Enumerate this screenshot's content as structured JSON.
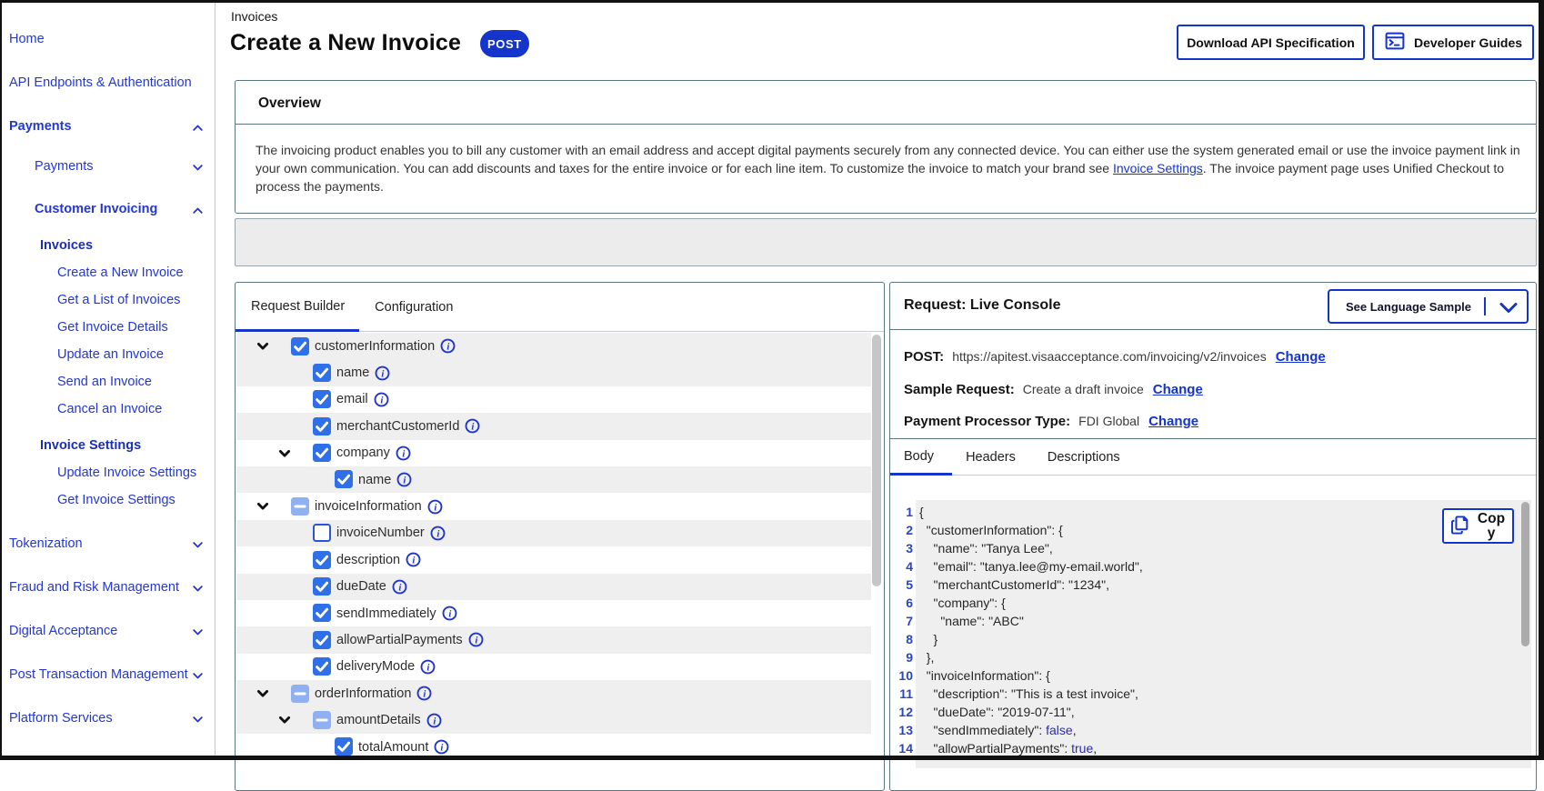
{
  "colors": {
    "accent": "#1434cb",
    "checkbox": "#2f6fe8",
    "checkbox_partial": "#8fb1f2",
    "panel_border": "#5a7584",
    "row_stripe": "#efefef"
  },
  "sidebar": {
    "items": [
      {
        "label": "Home",
        "style": "link",
        "indent": 0
      },
      {
        "label": "API Endpoints & Authentication",
        "style": "top-link",
        "indent": 0
      },
      {
        "label": "Payments",
        "style": "section",
        "indent": 0,
        "chevron": "up"
      },
      {
        "label": "Payments",
        "style": "sub-section",
        "indent": 1,
        "chevron": "down"
      },
      {
        "label": "Customer Invoicing",
        "style": "sub-section-bold",
        "indent": 1,
        "chevron": "up"
      },
      {
        "label": "Invoices",
        "style": "heading",
        "indent": 2
      },
      {
        "label": "Create a New Invoice",
        "style": "link",
        "indent": 3
      },
      {
        "label": "Get a List of Invoices",
        "style": "link",
        "indent": 3
      },
      {
        "label": "Get Invoice Details",
        "style": "link",
        "indent": 3
      },
      {
        "label": "Update an Invoice",
        "style": "link",
        "indent": 3
      },
      {
        "label": "Send an Invoice",
        "style": "link",
        "indent": 3
      },
      {
        "label": "Cancel an Invoice",
        "style": "link",
        "indent": 3
      },
      {
        "label": "Invoice Settings",
        "style": "heading",
        "indent": 2
      },
      {
        "label": "Update Invoice Settings",
        "style": "link",
        "indent": 3
      },
      {
        "label": "Get Invoice Settings",
        "style": "link",
        "indent": 3
      },
      {
        "label": "Tokenization",
        "style": "top-link",
        "indent": 0,
        "chevron": "down"
      },
      {
        "label": "Fraud and Risk Management",
        "style": "top-link",
        "indent": 0,
        "chevron": "down"
      },
      {
        "label": "Digital Acceptance",
        "style": "top-link",
        "indent": 0,
        "chevron": "down"
      },
      {
        "label": "Post Transaction Management",
        "style": "top-link",
        "indent": 0,
        "chevron": "down"
      },
      {
        "label": "Platform Services",
        "style": "top-link",
        "indent": 0,
        "chevron": "down"
      }
    ]
  },
  "header": {
    "breadcrumb": "Invoices",
    "title": "Create a New Invoice",
    "method_badge": "POST",
    "download_button": "Download API Specification",
    "guides_button": "Developer Guides"
  },
  "overview": {
    "title": "Overview",
    "paragraph_before": "The invoicing product enables you to bill any customer with an email address and accept digital payments securely from any connected device. You can either use the system generated email or use the invoice payment link in\nyour own communication. You can add discounts and taxes for the entire invoice or for each line item. To customize the invoice to match your brand see ",
    "paragraph_link": "Invoice Settings",
    "paragraph_after": ". The invoice payment page uses Unified Checkout to\nprocess the payments."
  },
  "request_builder": {
    "tabs": [
      {
        "label": "Request Builder",
        "active": true
      },
      {
        "label": "Configuration",
        "active": false
      }
    ],
    "rows": [
      {
        "label": "customerInformation",
        "depth": 0,
        "state": "checked",
        "chevron": true,
        "shade": "gray"
      },
      {
        "label": "name",
        "depth": 1,
        "state": "checked",
        "chevron": false,
        "shade": "gray"
      },
      {
        "label": "email",
        "depth": 1,
        "state": "checked",
        "chevron": false,
        "shade": "white"
      },
      {
        "label": "merchantCustomerId",
        "depth": 1,
        "state": "checked",
        "chevron": false,
        "shade": "gray"
      },
      {
        "label": "company",
        "depth": 1,
        "state": "checked",
        "chevron": true,
        "shade": "white"
      },
      {
        "label": "name",
        "depth": 2,
        "state": "checked",
        "chevron": false,
        "shade": "gray"
      },
      {
        "label": "invoiceInformation",
        "depth": 0,
        "state": "partial",
        "chevron": true,
        "shade": "white"
      },
      {
        "label": "invoiceNumber",
        "depth": 1,
        "state": "unchecked",
        "chevron": false,
        "shade": "gray"
      },
      {
        "label": "description",
        "depth": 1,
        "state": "checked",
        "chevron": false,
        "shade": "white"
      },
      {
        "label": "dueDate",
        "depth": 1,
        "state": "checked",
        "chevron": false,
        "shade": "gray"
      },
      {
        "label": "sendImmediately",
        "depth": 1,
        "state": "checked",
        "chevron": false,
        "shade": "white"
      },
      {
        "label": "allowPartialPayments",
        "depth": 1,
        "state": "checked",
        "chevron": false,
        "shade": "gray"
      },
      {
        "label": "deliveryMode",
        "depth": 1,
        "state": "checked",
        "chevron": false,
        "shade": "white"
      },
      {
        "label": "orderInformation",
        "depth": 0,
        "state": "partial",
        "chevron": true,
        "shade": "gray"
      },
      {
        "label": "amountDetails",
        "depth": 1,
        "state": "partial",
        "chevron": true,
        "shade": "gray"
      },
      {
        "label": "totalAmount",
        "depth": 2,
        "state": "checked",
        "chevron": false,
        "shade": "white"
      }
    ]
  },
  "console": {
    "title": "Request: Live Console",
    "language_button": "See Language Sample",
    "fields": [
      {
        "label": "POST:",
        "value": "https://apitest.visaacceptance.com/invoicing/v2/invoices",
        "action": "Change"
      },
      {
        "label": "Sample Request:",
        "value": "Create a draft invoice",
        "action": "Change"
      },
      {
        "label": "Payment Processor Type:",
        "value": "FDI Global",
        "action": "Change"
      }
    ],
    "tabs": [
      {
        "label": "Body",
        "active": true
      },
      {
        "label": "Headers",
        "active": false
      },
      {
        "label": "Descriptions",
        "active": false
      }
    ],
    "copy_button": "Copy",
    "code_lines": [
      {
        "n": "1",
        "segs": [
          [
            "{",
            "t"
          ]
        ]
      },
      {
        "n": "2",
        "segs": [
          [
            "  \"customerInformation\": {",
            "t"
          ]
        ]
      },
      {
        "n": "3",
        "segs": [
          [
            "    \"name\": \"Tanya Lee\",",
            "t"
          ]
        ]
      },
      {
        "n": "4",
        "segs": [
          [
            "    \"email\": \"tanya.lee@my-email.world\",",
            "t"
          ]
        ]
      },
      {
        "n": "5",
        "segs": [
          [
            "    \"merchantCustomerId\": \"1234\",",
            "t"
          ]
        ]
      },
      {
        "n": "6",
        "segs": [
          [
            "    \"company\": {",
            "t"
          ]
        ]
      },
      {
        "n": "7",
        "segs": [
          [
            "      \"name\": \"ABC\"",
            "t"
          ]
        ]
      },
      {
        "n": "8",
        "segs": [
          [
            "    }",
            "t"
          ]
        ]
      },
      {
        "n": "9",
        "segs": [
          [
            "  },",
            "t"
          ]
        ]
      },
      {
        "n": "10",
        "segs": [
          [
            "  \"invoiceInformation\": {",
            "t"
          ]
        ]
      },
      {
        "n": "11",
        "segs": [
          [
            "    \"description\": \"This is a test invoice\",",
            "t"
          ]
        ]
      },
      {
        "n": "12",
        "segs": [
          [
            "    \"dueDate\": \"2019-07-11\",",
            "t"
          ]
        ]
      },
      {
        "n": "13",
        "segs": [
          [
            "    \"sendImmediately\": ",
            "t"
          ],
          [
            "false",
            "b"
          ],
          [
            ",",
            "t"
          ]
        ]
      },
      {
        "n": "14",
        "segs": [
          [
            "    \"allowPartialPayments\": ",
            "t"
          ],
          [
            "true",
            "b"
          ],
          [
            ",",
            "t"
          ]
        ]
      }
    ]
  }
}
